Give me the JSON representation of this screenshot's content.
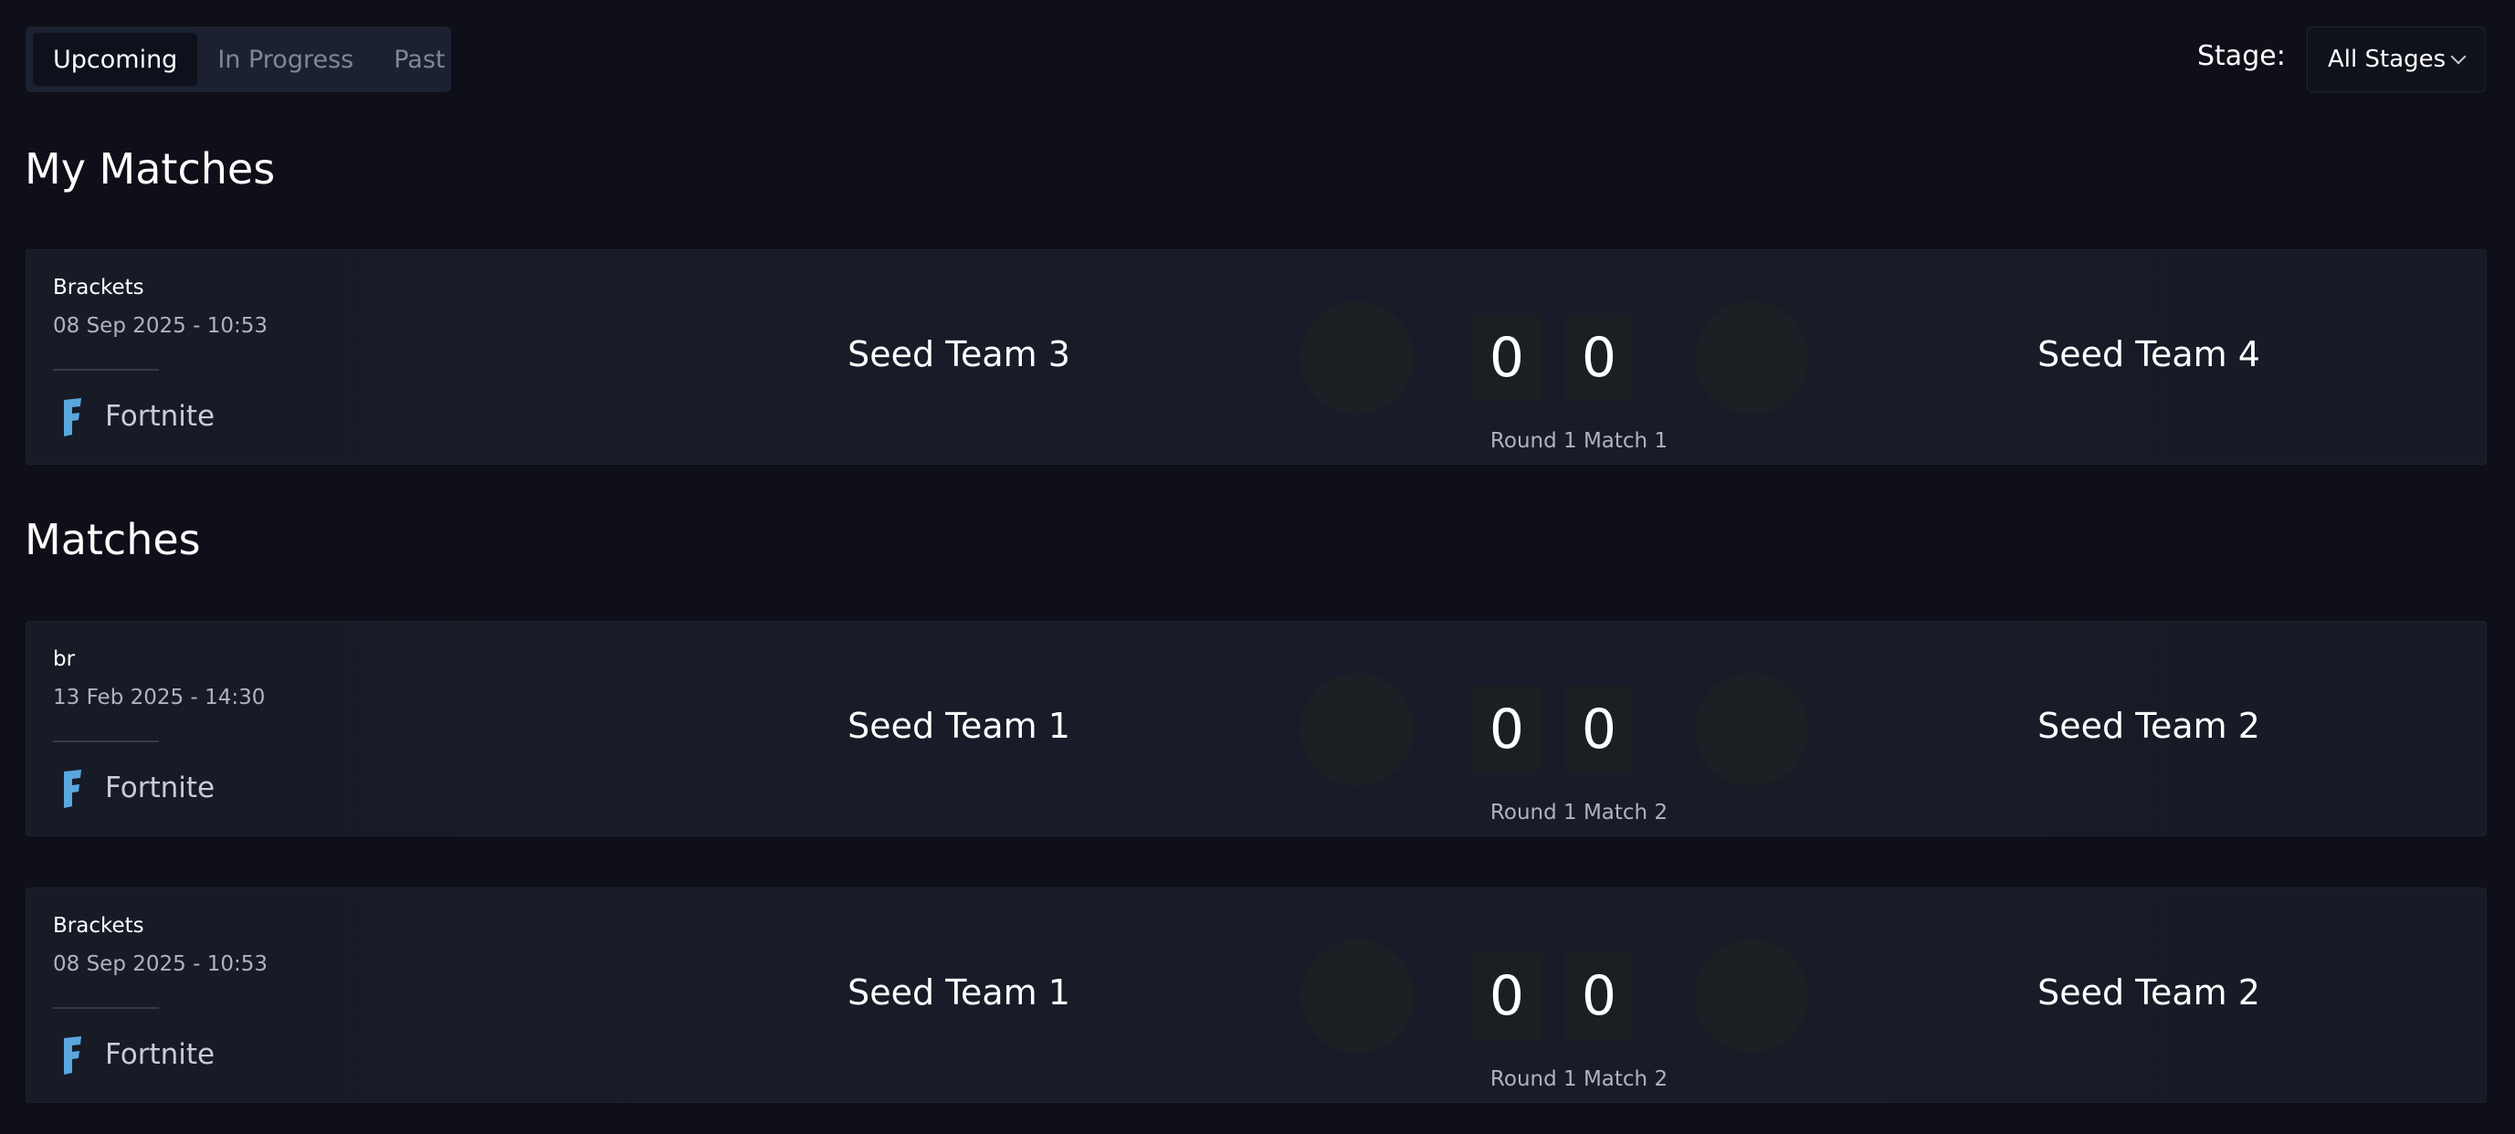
{
  "tabs": [
    {
      "label": "Upcoming",
      "active": true
    },
    {
      "label": "In Progress",
      "active": false
    },
    {
      "label": "Past",
      "active": false
    }
  ],
  "stage_filter": {
    "label": "Stage:",
    "selected": "All Stages"
  },
  "sections": {
    "my_matches": "My Matches",
    "matches": "Matches"
  },
  "my_matches": [
    {
      "title": "Brackets",
      "date": "08 Sep 2025 - 10:53",
      "game": "Fortnite",
      "team_a": "Seed Team 3",
      "team_b": "Seed Team 4",
      "score_a": "0",
      "score_b": "0",
      "round": "Round 1 Match 1"
    }
  ],
  "matches": [
    {
      "title": "br",
      "date": "13 Feb 2025 - 14:30",
      "game": "Fortnite",
      "team_a": "Seed Team 1",
      "team_b": "Seed Team 2",
      "score_a": "0",
      "score_b": "0",
      "round": "Round 1 Match 2"
    },
    {
      "title": "Brackets",
      "date": "08 Sep 2025 - 10:53",
      "game": "Fortnite",
      "team_a": "Seed Team 1",
      "team_b": "Seed Team 2",
      "score_a": "0",
      "score_b": "0",
      "round": "Round 1 Match 2"
    }
  ],
  "icons": {
    "game": "fortnite-icon",
    "stage_dropdown": "chevron-down-icon"
  },
  "colors": {
    "background": "#0e0f18",
    "card": "#171b26",
    "game_icon": "#5aa7de"
  }
}
